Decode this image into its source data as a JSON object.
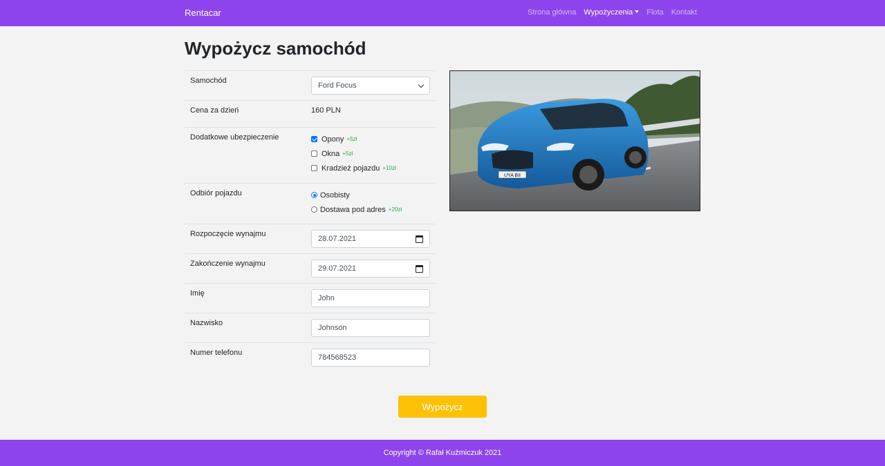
{
  "navbar": {
    "brand": "Rentacar",
    "links": [
      "Strona główna",
      "Wypożyczenia",
      "Flota",
      "Kontakt"
    ],
    "active_index": 1
  },
  "page_title": "Wypożycz samochód",
  "form": {
    "car_label": "Samochód",
    "car_value": "Ford Focus",
    "price_label": "Cena za dzień",
    "price_value": "160 PLN",
    "insurance_label": "Dodatkowe ubezpieczenie",
    "insurance_options": [
      {
        "label": "Opony",
        "extra": "+5zł",
        "checked": true
      },
      {
        "label": "Okna",
        "extra": "+5zł",
        "checked": false
      },
      {
        "label": "Kradzież pojazdu",
        "extra": "+10zł",
        "checked": false
      }
    ],
    "pickup_label": "Odbiór pojazdu",
    "pickup_options": [
      {
        "label": "Osobisty",
        "extra": "",
        "checked": true
      },
      {
        "label": "Dostawa pod adres",
        "extra": "+20zł",
        "checked": false
      }
    ],
    "start_label": "Rozpoczęcie wynajmu",
    "start_value": "28.07.2021",
    "end_label": "Zakończenie wynajmu",
    "end_value": "29.07.2021",
    "first_name_label": "Imię",
    "first_name_value": "John",
    "last_name_label": "Nazwisko",
    "last_name_value": "Johnson",
    "phone_label": "Numer telefonu",
    "phone_value": "784568523"
  },
  "car_plate": "UYA BII",
  "submit_label": "Wypożycz",
  "footer_text": "Copyright © Rafał Kuźmiczuk 2021",
  "colors": {
    "primary": "#8e44ec",
    "accent": "#ffc107",
    "extra_price": "#28a745",
    "check": "#0075ff"
  }
}
